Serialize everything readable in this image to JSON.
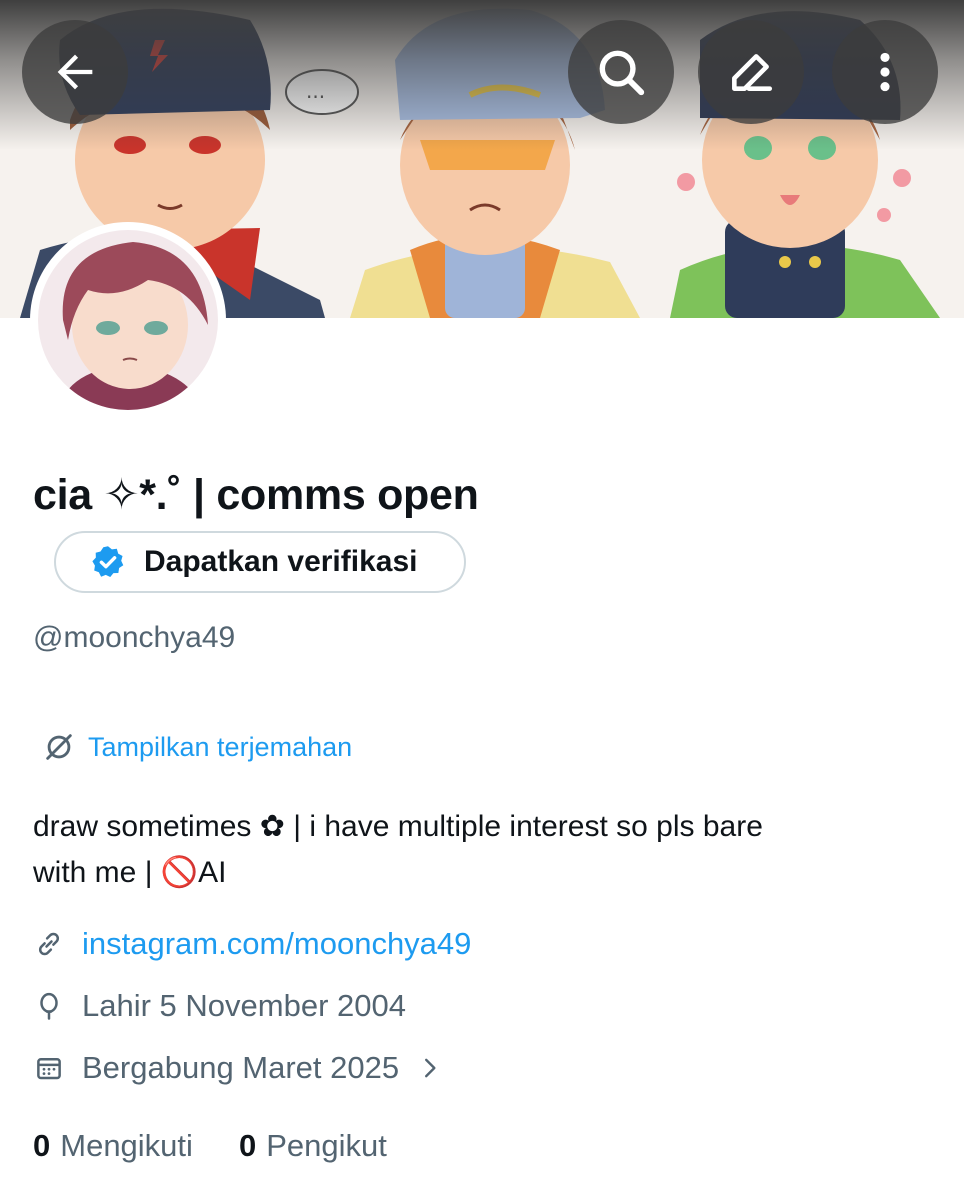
{
  "profile": {
    "display_name": "cia ✧*.˚ | comms open",
    "verify_button_label": "Dapatkan verifikasi",
    "handle": "@moonchya49",
    "translate_label": "Tampilkan terjemahan",
    "bio_line1": "draw sometimes ✿ | i have multiple interest so pls bare",
    "bio_line2": "with me | 🚫AI",
    "website": "instagram.com/moonchya49",
    "birthday": "Lahir 5 November 2004",
    "joined": "Bergabung Maret 2025",
    "following_count": "0",
    "following_label": "Mengikuti",
    "followers_count": "0",
    "followers_label": "Pengikut"
  },
  "header": {
    "back_icon": "arrow-left-icon",
    "search_icon": "search-icon",
    "edit_icon": "edit-icon",
    "more_icon": "more-vertical-icon"
  },
  "colors": {
    "accent": "#1d9bf0",
    "secondary_text": "#536471",
    "primary_text": "#0f1419",
    "border": "#cfd9de"
  }
}
